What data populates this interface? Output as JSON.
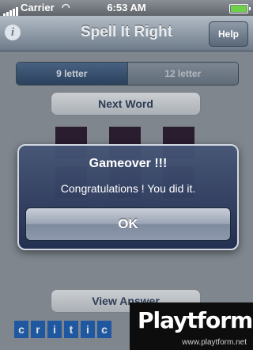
{
  "status_bar": {
    "carrier": "Carrier",
    "time": "6:53 AM"
  },
  "nav": {
    "info_glyph": "i",
    "title": "Spell It Right",
    "help_label": "Help"
  },
  "segment": {
    "options": [
      "9 letter",
      "12 letter"
    ],
    "selected_index": 0
  },
  "buttons": {
    "next_word": "Next Word",
    "view_answer": "View Answer"
  },
  "letters": [
    "c",
    "r",
    "i",
    "t",
    "i",
    "c"
  ],
  "alert": {
    "title": "Gameover !!!",
    "message": "Congratulations ! You did it.",
    "ok_label": "OK"
  },
  "watermark": {
    "brand": "Playtform",
    "url": "www.playtform.net"
  },
  "colors": {
    "nav_bar": "#8f9aa7",
    "tile": "#2a1a2e",
    "letter_tile": "#1e5fb3",
    "alert_bg": "#2f3e66"
  }
}
